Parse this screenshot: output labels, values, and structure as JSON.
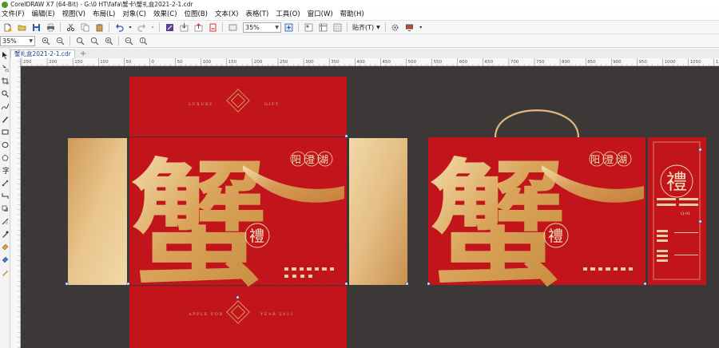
{
  "window": {
    "title": "CorelDRAW X7 (64-Bit) - G:\\0 HT\\fafa\\蟹卡\\蟹礼盒2021-2-1.cdr"
  },
  "menu": [
    "文件(F)",
    "编辑(E)",
    "视图(V)",
    "布局(L)",
    "对象(C)",
    "效果(C)",
    "位图(B)",
    "文本(X)",
    "表格(T)",
    "工具(O)",
    "窗口(W)",
    "帮助(H)"
  ],
  "toolbar": {
    "zoom_value": "35%",
    "snap_label": "贴齐(T)"
  },
  "propertybar": {
    "zoom_value": "35%"
  },
  "document_tab": {
    "label": "蟹礼盒2021-2-1.cdr"
  },
  "ruler": {
    "labels": [
      "250",
      "200",
      "150",
      "100",
      "50",
      "0",
      "50",
      "100",
      "150",
      "200",
      "250",
      "300",
      "350",
      "400",
      "450",
      "500",
      "550",
      "600",
      "650",
      "700",
      "750",
      "800",
      "850",
      "900",
      "950",
      "1000",
      "1050",
      "1100",
      "1150"
    ]
  },
  "artwork": {
    "big_char": "蟹",
    "seal_char": "禮",
    "brand_chars": "阳澄湖",
    "flap_text_left": "LUXURY",
    "flap_text_right": "GIFT",
    "bottom_text_left": "APPLE FOR",
    "bottom_text_right": "YEAR 2021",
    "side_label": "Q-01"
  },
  "colors": {
    "canvas_bg": "#3c3838",
    "box_red": "#c1151b",
    "box_red_dark": "#a50f14",
    "gold": "#d6a864",
    "gold_light": "#f1d9a6",
    "selection_blue": "#1f4fa0"
  },
  "icons": {
    "new": "new-doc-icon",
    "open": "open-folder-icon",
    "save": "save-icon",
    "print": "printer-icon"
  }
}
